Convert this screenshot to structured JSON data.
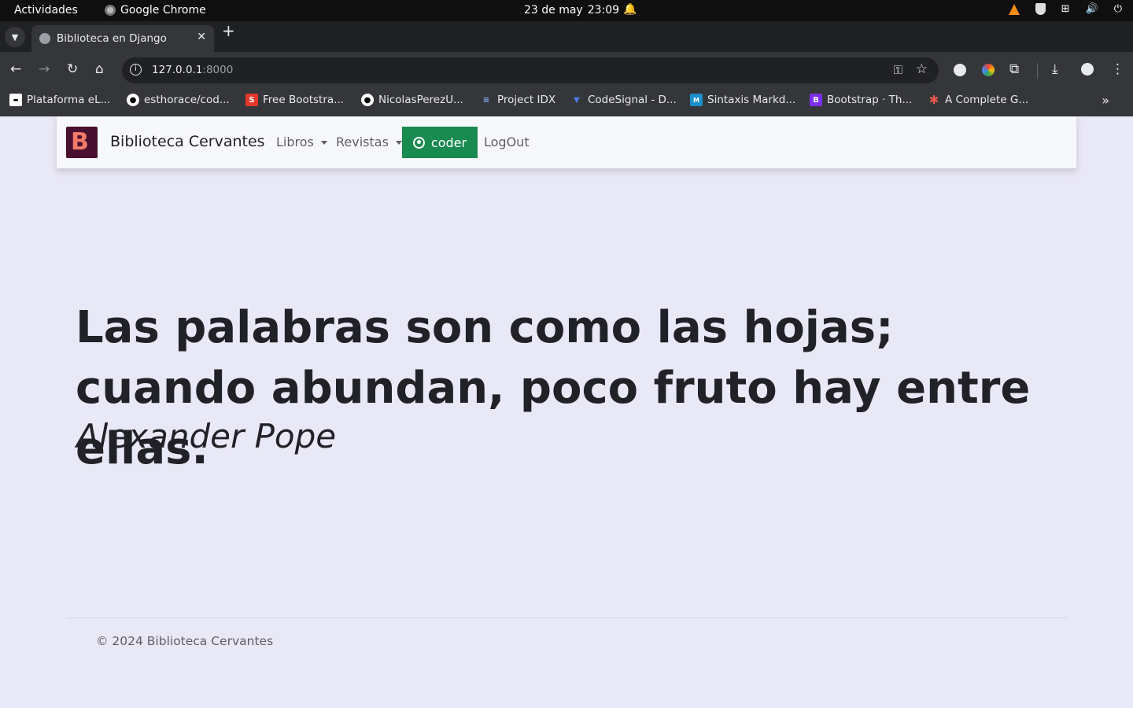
{
  "os_bar": {
    "activities": "Actividades",
    "app_name": "Google Chrome",
    "date": "23 de may",
    "time": "23:09"
  },
  "browser": {
    "tab_title": "Biblioteca en Django",
    "url_host": "127.0.0.1",
    "url_port": ":8000",
    "bookmarks": [
      {
        "label": "Plataforma eL...",
        "icon": "page-icon"
      },
      {
        "label": "esthorace/cod...",
        "icon": "github-icon"
      },
      {
        "label": "Free Bootstra...",
        "icon": "s-icon"
      },
      {
        "label": "NicolasPerezU...",
        "icon": "github-icon"
      },
      {
        "label": "Project IDX",
        "icon": "idx-icon"
      },
      {
        "label": "CodeSignal - D...",
        "icon": "codesignal-icon"
      },
      {
        "label": "Sintaxis Markd...",
        "icon": "markdown-icon"
      },
      {
        "label": "Bootstrap · Th...",
        "icon": "bootstrap-icon"
      },
      {
        "label": "A Complete G...",
        "icon": "asterisk-icon"
      }
    ]
  },
  "navbar": {
    "logo_letter": "B",
    "brand": "Biblioteca Cervantes",
    "libros": "Libros",
    "revistas": "Revistas",
    "user": "coder",
    "logout": "LogOut"
  },
  "main": {
    "quote": "Las palabras son como las hojas; cuando abundan, poco fruto hay entre ellas.",
    "author": "Alexander Pope"
  },
  "footer": {
    "text": "© 2024 Biblioteca Cervantes"
  }
}
